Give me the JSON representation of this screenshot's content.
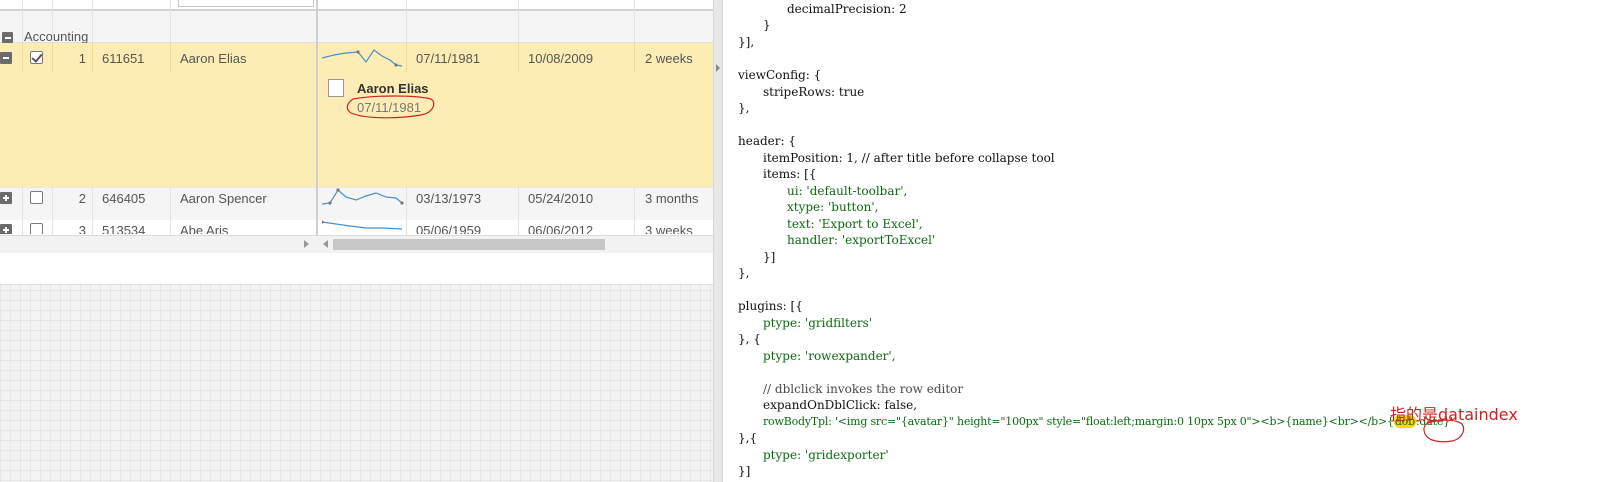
{
  "grid": {
    "group_label": "Accounting",
    "rows": [
      {
        "number": "1",
        "id": "611651",
        "name": "Aaron Elias",
        "dob": "07/11/1981",
        "joined": "10/08/2009",
        "duration": "2 weeks",
        "checked": true,
        "expanded": true
      },
      {
        "number": "2",
        "id": "646405",
        "name": "Aaron Spencer",
        "dob": "03/13/1973",
        "joined": "05/24/2010",
        "duration": "3 months",
        "checked": false,
        "expanded": false
      },
      {
        "number": "3",
        "id": "513534",
        "name": "Abe Aris",
        "dob": "05/06/1959",
        "joined": "06/06/2012",
        "duration": "3 weeks",
        "checked": false,
        "expanded": false
      }
    ],
    "expander": {
      "name": "Aaron Elias",
      "dob": "07/11/1981"
    }
  },
  "code": {
    "lines": [
      {
        "indent": 6,
        "text": "decimalPrecision: 2"
      },
      {
        "indent": 4,
        "text": "}"
      },
      {
        "indent": 2,
        "text": "}],"
      },
      {
        "indent": 0,
        "text": ""
      },
      {
        "indent": 2,
        "text": "viewConfig: {"
      },
      {
        "indent": 4,
        "text": "stripeRows: true"
      },
      {
        "indent": 2,
        "text": "},"
      },
      {
        "indent": 0,
        "text": ""
      },
      {
        "indent": 2,
        "text": "header: {"
      },
      {
        "indent": 4,
        "text": "itemPosition: 1, // after title before collapse tool"
      },
      {
        "indent": 4,
        "text": "items: [{"
      },
      {
        "indent": 6,
        "text": "ui: 'default-toolbar',"
      },
      {
        "indent": 6,
        "text": "xtype: 'button',"
      },
      {
        "indent": 6,
        "text": "text: 'Export to Excel',"
      },
      {
        "indent": 6,
        "text": "handler: 'exportToExcel'"
      },
      {
        "indent": 4,
        "text": "}]"
      },
      {
        "indent": 2,
        "text": "},"
      },
      {
        "indent": 0,
        "text": ""
      },
      {
        "indent": 2,
        "text": "plugins: [{"
      },
      {
        "indent": 4,
        "text": "ptype: 'gridfilters'"
      },
      {
        "indent": 2,
        "text": "}, {"
      },
      {
        "indent": 4,
        "text": "ptype: 'rowexpander',"
      },
      {
        "indent": 0,
        "text": ""
      },
      {
        "indent": 4,
        "text": "// dblclick invokes the row editor"
      },
      {
        "indent": 4,
        "text": "expandOnDblClick: false,"
      },
      {
        "indent": 4,
        "text": "rowBodyTpl: '<img src=\"{avatar}\" height=\"100px\" style=\"float:left;margin:0 10px 5px 0\"><b>{name}<br></b>{dob:date}'"
      },
      {
        "indent": 2,
        "text": "},{"
      },
      {
        "indent": 4,
        "text": "ptype: 'gridexporter'"
      },
      {
        "indent": 2,
        "text": "}]"
      }
    ]
  },
  "annotation": {
    "text": "指的是dataindex",
    "color": "#d12222"
  },
  "colors": {
    "selected_row": "#fdedb5",
    "highlight": "#ffd400",
    "sparkline": "#4a90c8"
  }
}
